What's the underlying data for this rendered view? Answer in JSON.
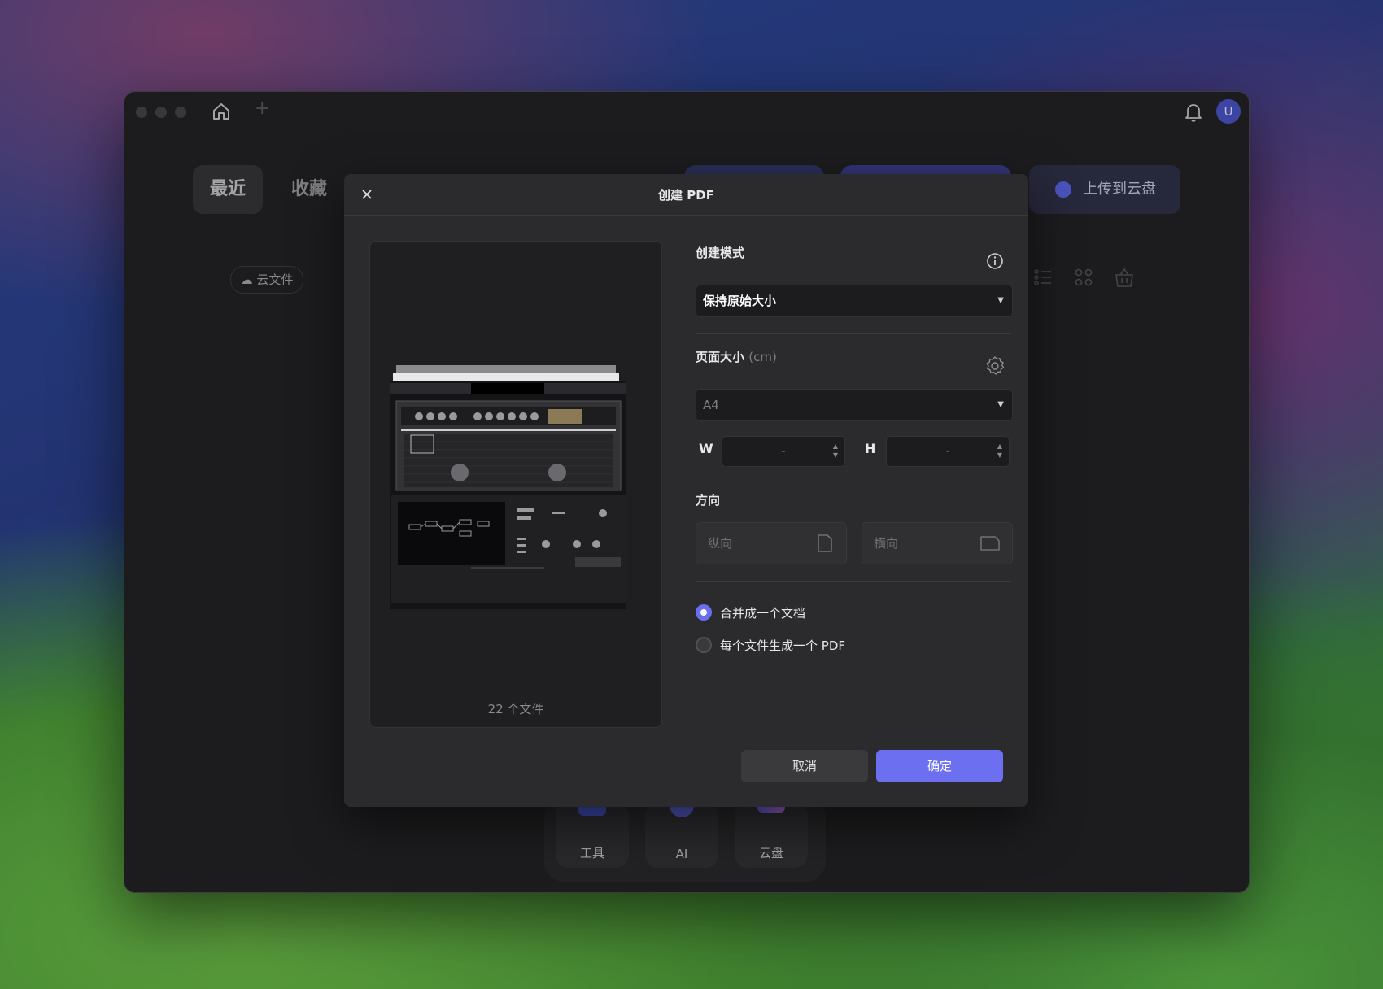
{
  "app": {
    "tabs": [
      "最近",
      "收藏"
    ],
    "upload_label": "上传到云盘",
    "cloud_files_label": "云文件",
    "avatar_letter": "U",
    "dock": [
      "工具",
      "AI",
      "云盘"
    ]
  },
  "dialog": {
    "title": "创建 PDF",
    "file_count": "22 个文件",
    "create_mode_label": "创建模式",
    "create_mode_value": "保持原始大小",
    "page_size_label": "页面大小",
    "page_size_unit": "(cm)",
    "page_size_value": "A4",
    "width_label": "W",
    "width_value": "-",
    "height_label": "H",
    "height_value": "-",
    "orientation_label": "方向",
    "portrait_label": "纵向",
    "landscape_label": "横向",
    "merge_option": "合并成一个文档",
    "separate_option": "每个文件生成一个 PDF",
    "merge_selected": true,
    "cancel_label": "取消",
    "ok_label": "确定"
  },
  "colors": {
    "accent": "#6b6ff0",
    "window_bg": "#232325",
    "dialog_bg": "#2b2b2d"
  }
}
